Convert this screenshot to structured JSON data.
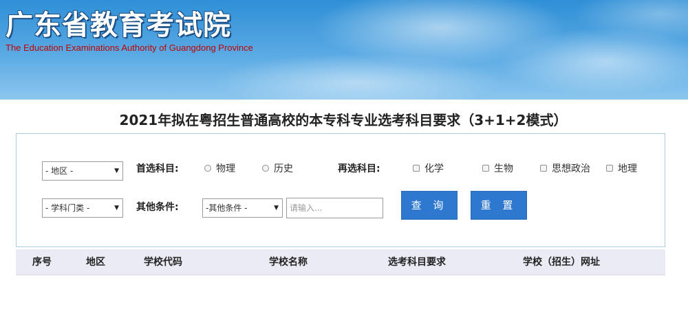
{
  "header": {
    "logo_cn": "广东省教育考试院",
    "logo_en": "The Education Examinations Authority of Guangdong Province"
  },
  "page_title": "2021年拟在粤招生普通高校的本专科专业选考科目要求（3+1+2模式）",
  "filters": {
    "region_select": "- 地区 -",
    "category_select": "- 学科门类 -",
    "first_choice_label": "首选科目:",
    "first_choice_options": [
      "物理",
      "历史"
    ],
    "second_choice_label": "再选科目:",
    "second_choice_options": [
      "化学",
      "生物",
      "思想政治",
      "地理"
    ],
    "other_label": "其他条件:",
    "other_select": "-其他条件 -",
    "input_placeholder": "请输入...",
    "search_button": "查 询",
    "reset_button": "重 置"
  },
  "table": {
    "columns": [
      "序号",
      "地区",
      "学校代码",
      "学校名称",
      "选考科目要求",
      "学校（招生）网址"
    ]
  },
  "colors": {
    "banner_blue": "#2f8fd6",
    "button_blue": "#2f78cf",
    "header_row_bg": "#ebebf6",
    "english_title_red": "#c00000"
  }
}
